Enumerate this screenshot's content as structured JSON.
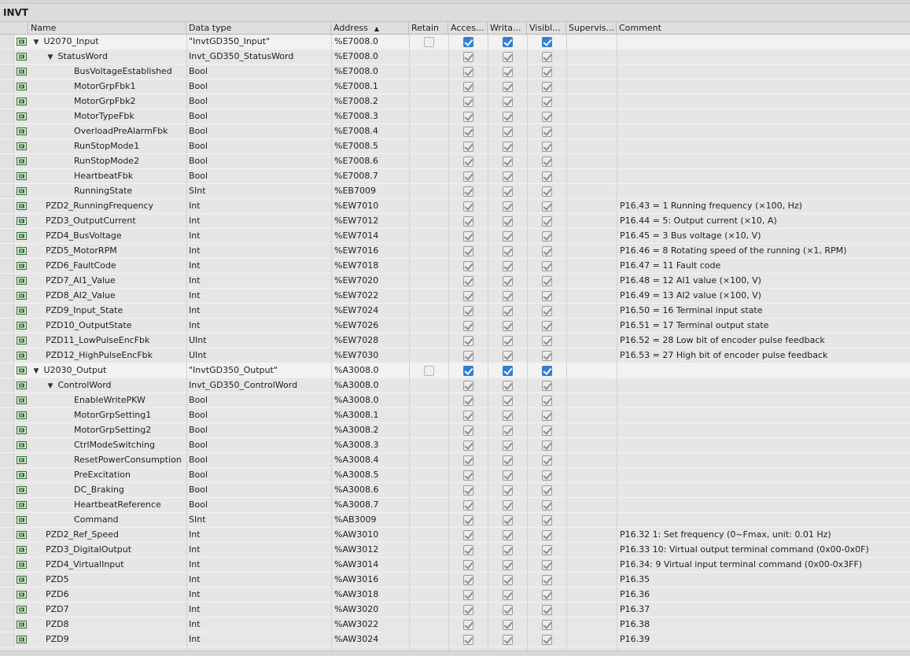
{
  "title": "INVT",
  "columns": {
    "name": "Name",
    "datatype": "Data type",
    "address": "Address",
    "retain": "Retain",
    "accessible": "Acces...",
    "writable": "Writa...",
    "visible": "Visibl...",
    "supervision": "Supervis...",
    "comment": "Comment"
  },
  "colors": {
    "checked_blue": "#2f80d6",
    "checked_gray": "#8c8c8c",
    "background": "#e6e6e6"
  },
  "icons": {
    "row": "tag-icon",
    "sort": "sort-ascending-icon",
    "expand": "triangle-down-icon"
  },
  "rows": [
    {
      "name": "U2070_Input",
      "level": 0,
      "expand": true,
      "datatype": "\"InvtGD350_Input\"",
      "address": "%E7008.0",
      "retain": "empty",
      "cbstyle": "blue",
      "comment": ""
    },
    {
      "name": "StatusWord",
      "level": 1,
      "expand": true,
      "datatype": "Invt_GD350_StatusWord",
      "address": "%E7008.0",
      "retain": "none",
      "cbstyle": "gray",
      "comment": ""
    },
    {
      "name": "BusVoltageEstablished",
      "level": 2,
      "expand": false,
      "datatype": "Bool",
      "address": "%E7008.0",
      "retain": "none",
      "cbstyle": "gray",
      "comment": ""
    },
    {
      "name": "MotorGrpFbk1",
      "level": 2,
      "expand": false,
      "datatype": "Bool",
      "address": "%E7008.1",
      "retain": "none",
      "cbstyle": "gray",
      "comment": ""
    },
    {
      "name": "MotorGrpFbk2",
      "level": 2,
      "expand": false,
      "datatype": "Bool",
      "address": "%E7008.2",
      "retain": "none",
      "cbstyle": "gray",
      "comment": ""
    },
    {
      "name": "MotorTypeFbk",
      "level": 2,
      "expand": false,
      "datatype": "Bool",
      "address": "%E7008.3",
      "retain": "none",
      "cbstyle": "gray",
      "comment": ""
    },
    {
      "name": "OverloadPreAlarmFbk",
      "level": 2,
      "expand": false,
      "datatype": "Bool",
      "address": "%E7008.4",
      "retain": "none",
      "cbstyle": "gray",
      "comment": ""
    },
    {
      "name": "RunStopMode1",
      "level": 2,
      "expand": false,
      "datatype": "Bool",
      "address": "%E7008.5",
      "retain": "none",
      "cbstyle": "gray",
      "comment": ""
    },
    {
      "name": "RunStopMode2",
      "level": 2,
      "expand": false,
      "datatype": "Bool",
      "address": "%E7008.6",
      "retain": "none",
      "cbstyle": "gray",
      "comment": ""
    },
    {
      "name": "HeartbeatFbk",
      "level": 2,
      "expand": false,
      "datatype": "Bool",
      "address": "%E7008.7",
      "retain": "none",
      "cbstyle": "gray",
      "comment": ""
    },
    {
      "name": "RunningState",
      "level": 2,
      "expand": false,
      "datatype": "SInt",
      "address": "%EB7009",
      "retain": "none",
      "cbstyle": "gray",
      "comment": ""
    },
    {
      "name": "PZD2_RunningFrequency",
      "level": 1,
      "expand": false,
      "datatype": "Int",
      "address": "%EW7010",
      "retain": "none",
      "cbstyle": "gray",
      "comment": "P16.43 = 1 Running frequency (×100, Hz)"
    },
    {
      "name": "PZD3_OutputCurrent",
      "level": 1,
      "expand": false,
      "datatype": "Int",
      "address": "%EW7012",
      "retain": "none",
      "cbstyle": "gray",
      "comment": "P16.44 = 5: Output current (×10, A)"
    },
    {
      "name": "PZD4_BusVoltage",
      "level": 1,
      "expand": false,
      "datatype": "Int",
      "address": "%EW7014",
      "retain": "none",
      "cbstyle": "gray",
      "comment": "P16.45 = 3 Bus voltage (×10, V)"
    },
    {
      "name": "PZD5_MotorRPM",
      "level": 1,
      "expand": false,
      "datatype": "Int",
      "address": "%EW7016",
      "retain": "none",
      "cbstyle": "gray",
      "comment": "P16.46 = 8 Rotating speed of the running (×1, RPM)"
    },
    {
      "name": "PZD6_FaultCode",
      "level": 1,
      "expand": false,
      "datatype": "Int",
      "address": "%EW7018",
      "retain": "none",
      "cbstyle": "gray",
      "comment": "P16.47 = 11 Fault code"
    },
    {
      "name": "PZD7_AI1_Value",
      "level": 1,
      "expand": false,
      "datatype": "Int",
      "address": "%EW7020",
      "retain": "none",
      "cbstyle": "gray",
      "comment": "P16.48 = 12 AI1 value (×100, V)"
    },
    {
      "name": "PZD8_AI2_Value",
      "level": 1,
      "expand": false,
      "datatype": "Int",
      "address": "%EW7022",
      "retain": "none",
      "cbstyle": "gray",
      "comment": "P16.49 = 13 AI2 value (×100, V)"
    },
    {
      "name": "PZD9_Input_State",
      "level": 1,
      "expand": false,
      "datatype": "Int",
      "address": "%EW7024",
      "retain": "none",
      "cbstyle": "gray",
      "comment": "P16.50 = 16 Terminal input state"
    },
    {
      "name": "PZD10_OutputState",
      "level": 1,
      "expand": false,
      "datatype": "Int",
      "address": "%EW7026",
      "retain": "none",
      "cbstyle": "gray",
      "comment": "P16.51 = 17 Terminal output state"
    },
    {
      "name": "PZD11_LowPulseEncFbk",
      "level": 1,
      "expand": false,
      "datatype": "UInt",
      "address": "%EW7028",
      "retain": "none",
      "cbstyle": "gray",
      "comment": "P16.52 = 28 Low bit of encoder pulse feedback"
    },
    {
      "name": "PZD12_HighPulseEncFbk",
      "level": 1,
      "expand": false,
      "datatype": "UInt",
      "address": "%EW7030",
      "retain": "none",
      "cbstyle": "gray",
      "comment": "P16.53 = 27 High bit of encoder pulse feedback"
    },
    {
      "name": "U2030_Output",
      "level": 0,
      "expand": true,
      "datatype": "\"InvtGD350_Output\"",
      "address": "%A3008.0",
      "retain": "empty",
      "cbstyle": "blue",
      "comment": ""
    },
    {
      "name": "ControlWord",
      "level": 1,
      "expand": true,
      "datatype": "Invt_GD350_ControlWord",
      "address": "%A3008.0",
      "retain": "none",
      "cbstyle": "gray",
      "comment": ""
    },
    {
      "name": "EnableWritePKW",
      "level": 2,
      "expand": false,
      "datatype": "Bool",
      "address": "%A3008.0",
      "retain": "none",
      "cbstyle": "gray",
      "comment": ""
    },
    {
      "name": "MotorGrpSetting1",
      "level": 2,
      "expand": false,
      "datatype": "Bool",
      "address": "%A3008.1",
      "retain": "none",
      "cbstyle": "gray",
      "comment": ""
    },
    {
      "name": "MotorGrpSetting2",
      "level": 2,
      "expand": false,
      "datatype": "Bool",
      "address": "%A3008.2",
      "retain": "none",
      "cbstyle": "gray",
      "comment": ""
    },
    {
      "name": "CtrlModeSwitching",
      "level": 2,
      "expand": false,
      "datatype": "Bool",
      "address": "%A3008.3",
      "retain": "none",
      "cbstyle": "gray",
      "comment": ""
    },
    {
      "name": "ResetPowerConsumption",
      "level": 2,
      "expand": false,
      "datatype": "Bool",
      "address": "%A3008.4",
      "retain": "none",
      "cbstyle": "gray",
      "comment": ""
    },
    {
      "name": "PreExcitation",
      "level": 2,
      "expand": false,
      "datatype": "Bool",
      "address": "%A3008.5",
      "retain": "none",
      "cbstyle": "gray",
      "comment": ""
    },
    {
      "name": "DC_Braking",
      "level": 2,
      "expand": false,
      "datatype": "Bool",
      "address": "%A3008.6",
      "retain": "none",
      "cbstyle": "gray",
      "comment": ""
    },
    {
      "name": "HeartbeatReference",
      "level": 2,
      "expand": false,
      "datatype": "Bool",
      "address": "%A3008.7",
      "retain": "none",
      "cbstyle": "gray",
      "comment": ""
    },
    {
      "name": "Command",
      "level": 2,
      "expand": false,
      "datatype": "SInt",
      "address": "%AB3009",
      "retain": "none",
      "cbstyle": "gray",
      "comment": ""
    },
    {
      "name": "PZD2_Ref_Speed",
      "level": 1,
      "expand": false,
      "datatype": "Int",
      "address": "%AW3010",
      "retain": "none",
      "cbstyle": "gray",
      "comment": "P16.32 1: Set frequency (0~Fmax, unit: 0.01 Hz)"
    },
    {
      "name": "PZD3_DigitalOutput",
      "level": 1,
      "expand": false,
      "datatype": "Int",
      "address": "%AW3012",
      "retain": "none",
      "cbstyle": "gray",
      "comment": "P16.33 10: Virtual output terminal command (0x00-0x0F)"
    },
    {
      "name": "PZD4_VirtualInput",
      "level": 1,
      "expand": false,
      "datatype": "Int",
      "address": "%AW3014",
      "retain": "none",
      "cbstyle": "gray",
      "comment": "P16.34: 9 Virtual input terminal command  (0x00-0x3FF)"
    },
    {
      "name": "PZD5",
      "level": 1,
      "expand": false,
      "datatype": "Int",
      "address": "%AW3016",
      "retain": "none",
      "cbstyle": "gray",
      "comment": "P16.35"
    },
    {
      "name": "PZD6",
      "level": 1,
      "expand": false,
      "datatype": "Int",
      "address": "%AW3018",
      "retain": "none",
      "cbstyle": "gray",
      "comment": "P16.36"
    },
    {
      "name": "PZD7",
      "level": 1,
      "expand": false,
      "datatype": "Int",
      "address": "%AW3020",
      "retain": "none",
      "cbstyle": "gray",
      "comment": "P16.37"
    },
    {
      "name": "PZD8",
      "level": 1,
      "expand": false,
      "datatype": "Int",
      "address": "%AW3022",
      "retain": "none",
      "cbstyle": "gray",
      "comment": "P16.38"
    },
    {
      "name": "PZD9",
      "level": 1,
      "expand": false,
      "datatype": "Int",
      "address": "%AW3024",
      "retain": "none",
      "cbstyle": "gray",
      "comment": "P16.39"
    }
  ]
}
